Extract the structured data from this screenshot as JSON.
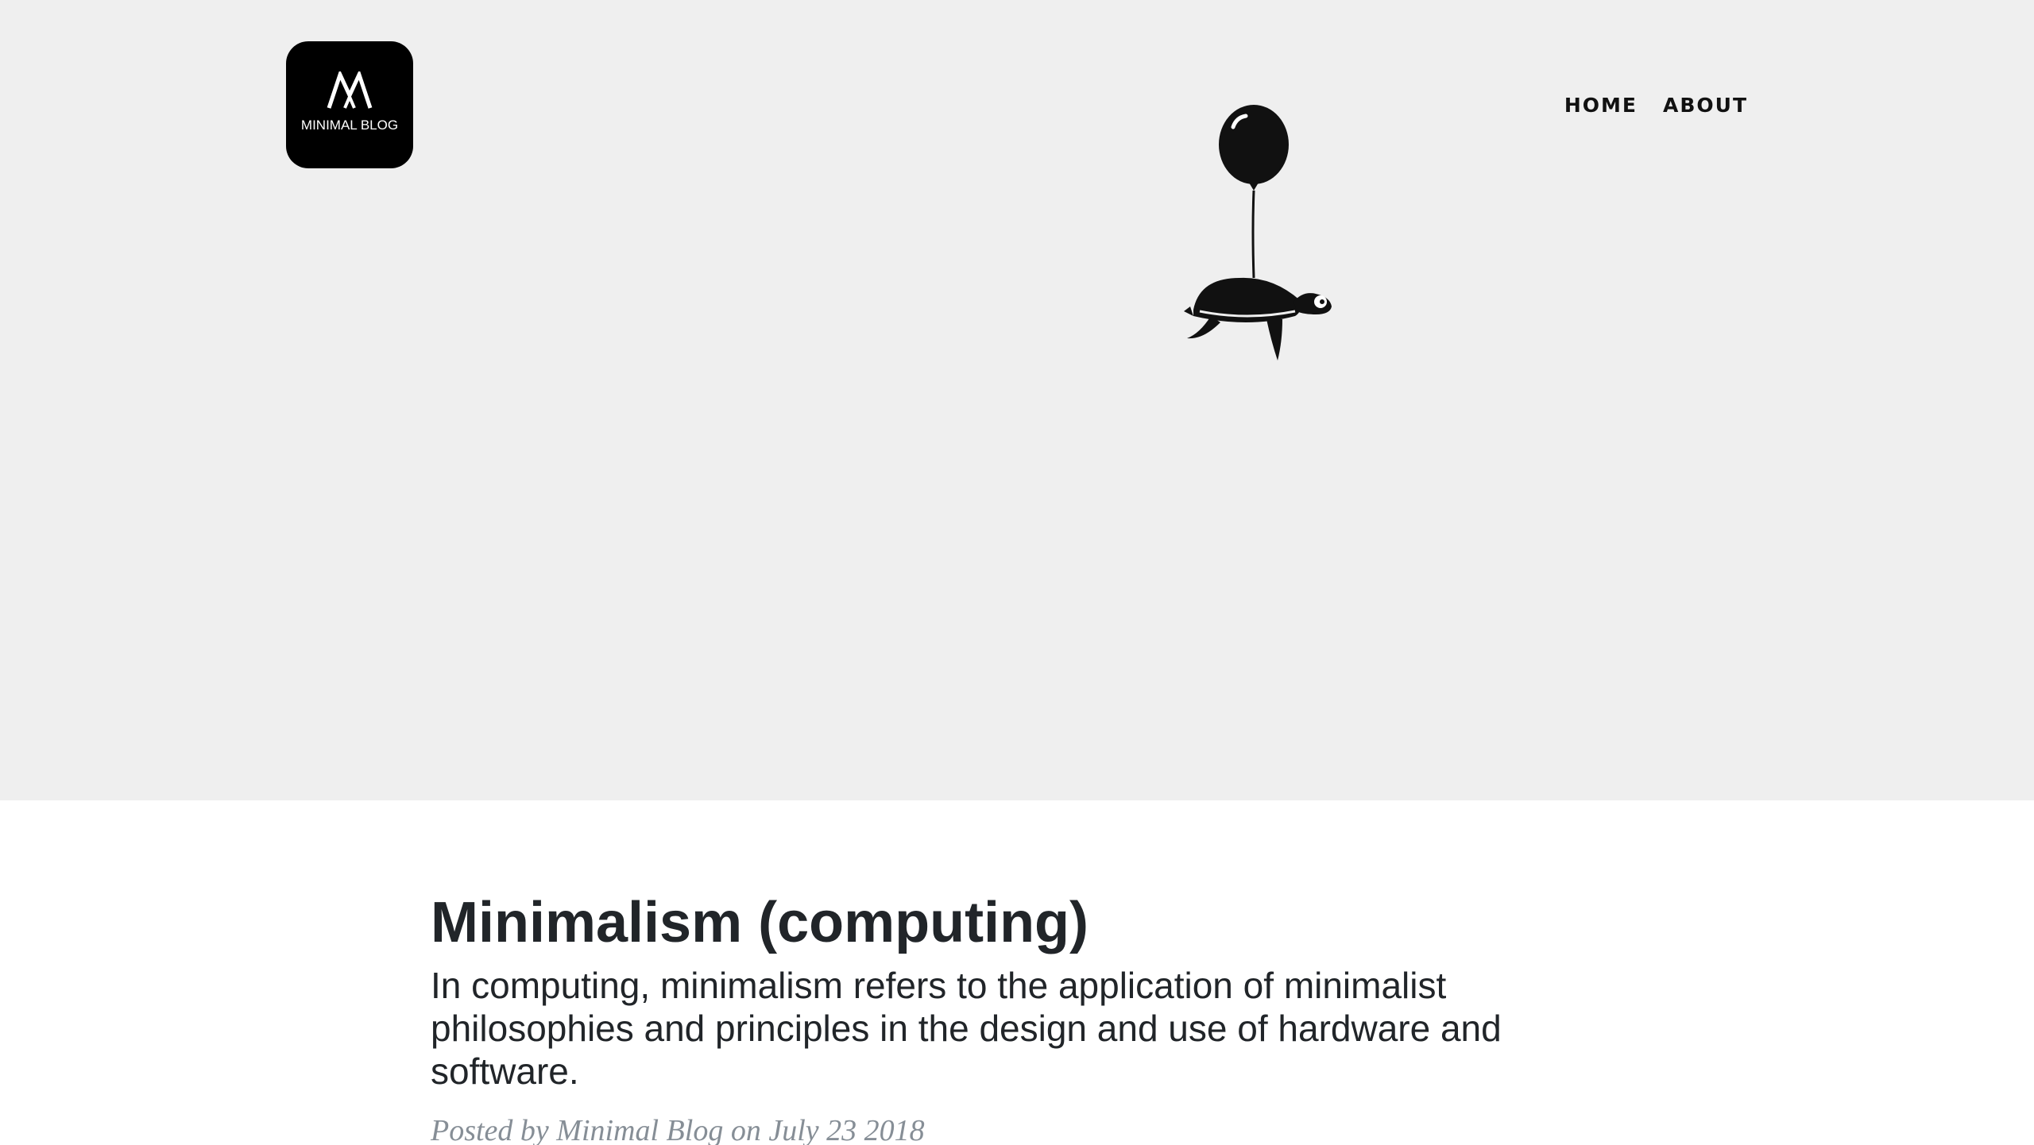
{
  "logo": {
    "text": "MINIMAL BLOG"
  },
  "nav": {
    "items": [
      {
        "label": "HOME"
      },
      {
        "label": "ABOUT"
      }
    ]
  },
  "hero": {
    "illustration": "turtle-with-balloon"
  },
  "post": {
    "title": "Minimalism (computing)",
    "subtitle": "In computing, minimalism refers to the application of minimalist philosophies and principles in the design and use of hardware and software.",
    "meta": "Posted by Minimal Blog on July 23 2018"
  },
  "colors": {
    "hero_bg": "#efefef",
    "logo_bg": "#000000",
    "text": "#212529",
    "meta": "#868e96"
  }
}
